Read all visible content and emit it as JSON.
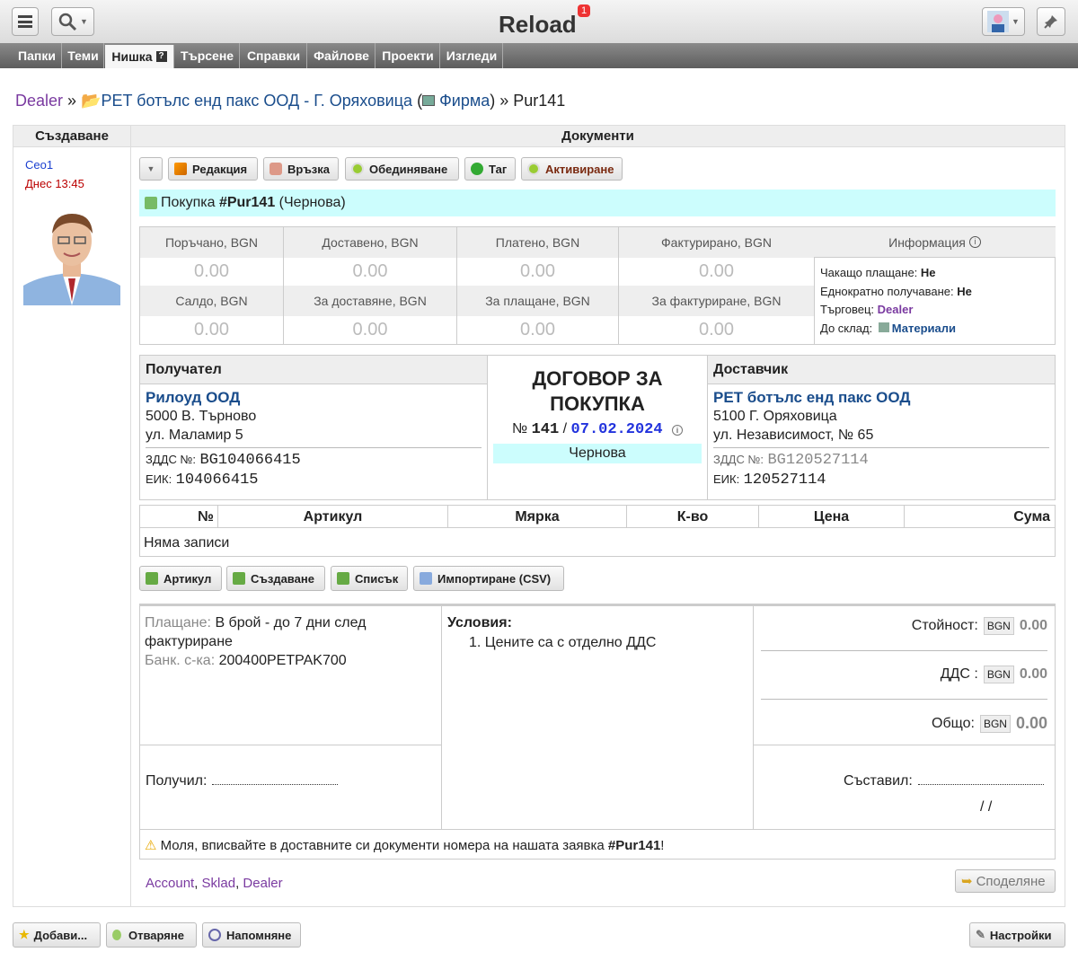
{
  "app": {
    "title": "Reload",
    "badge": "1"
  },
  "tabs": [
    "Папки",
    "Теми",
    "Нишка",
    "Търсене",
    "Справки",
    "Файлове",
    "Проекти",
    "Изгледи"
  ],
  "breadcrumb": {
    "user": "Dealer",
    "sep": "»",
    "company": "PET ботълс енд пакс ООД - Г. Оряховица",
    "paren_open": "(",
    "company_type": "Фирма",
    "paren_close": ")",
    "sep2": "»",
    "doc": "Pur141"
  },
  "side": {
    "header": "Създаване",
    "user": "Ceo1",
    "time": "Днес 13:45"
  },
  "docs": {
    "header": "Документи"
  },
  "actions": [
    "Редакция",
    "Връзка",
    "Обединяване",
    "Таг",
    "Активиране"
  ],
  "doc_title": {
    "prefix": "Покупка",
    "number": "#Pur141",
    "status": "(Чернова)"
  },
  "sums": {
    "row1": [
      "Поръчано, BGN",
      "Доставено, BGN",
      "Платено, BGN",
      "Фактурирано, BGN"
    ],
    "row1v": [
      "0.00",
      "0.00",
      "0.00",
      "0.00"
    ],
    "row2": [
      "Салдо, BGN",
      "За доставяне, BGN",
      "За плащане, BGN",
      "За фактуриране, BGN"
    ],
    "row2v": [
      "0.00",
      "0.00",
      "0.00",
      "0.00"
    ],
    "info_header": "Информация",
    "info": [
      {
        "k": "Чакащо плащане:",
        "v": "Не"
      },
      {
        "k": "Еднократно получаване:",
        "v": "Не"
      },
      {
        "k": "Търговец:",
        "v": "Dealer"
      },
      {
        "k": "До склад:",
        "v": "Материали"
      }
    ]
  },
  "receiver": {
    "header": "Получател",
    "name": "Рилоуд ООД",
    "addr1": "5000 В. Търново",
    "addr2": "ул. Маламир 5",
    "vat_label": "ЗДДС №:",
    "vat": "BG104066415",
    "eik_label": "ЕИК:",
    "eik": "104066415"
  },
  "contract": {
    "title1": "ДОГОВОР ЗА",
    "title2": "ПОКУПКА",
    "no_label": "№",
    "no": "141",
    "slash": "/",
    "date": "07.02.2024",
    "status": "Чернова"
  },
  "supplier": {
    "header": "Доставчик",
    "name": "PET ботълс енд пакс ООД",
    "addr1": "5100 Г. Оряховица",
    "addr2": "ул. Независимост, № 65",
    "vat_label": "ЗДДС №:",
    "vat": "BG120527114",
    "eik_label": "ЕИК:",
    "eik": "120527114"
  },
  "items": {
    "cols": [
      "№",
      "Артикул",
      "Мярка",
      "К-во",
      "Цена",
      "Сума"
    ],
    "empty": "Няма записи"
  },
  "item_buttons": [
    "Артикул",
    "Създаване",
    "Списък",
    "Импортиране (CSV)"
  ],
  "payment": {
    "label": "Плащане:",
    "value": "В брой - до 7 дни след фактуриране",
    "bank_label": "Банк. с-ка:",
    "bank": "200400PETPAK700"
  },
  "conditions": {
    "header": "Условия:",
    "items": [
      "1. Цените са с отделно ДДС"
    ]
  },
  "totals": [
    {
      "label": "Стойност:",
      "cur": "BGN",
      "value": "0.00"
    },
    {
      "label": "ДДС :",
      "cur": "BGN",
      "value": "0.00"
    },
    {
      "label": "Общо:",
      "cur": "BGN",
      "value": "0.00"
    }
  ],
  "received": "Получил:",
  "compiled": "Съставил:",
  "date_blank": "/ /",
  "warning": {
    "text": "Моля, вписвайте в доставните си документи номера на нашата заявка",
    "ref": "#Pur141",
    "tail": "!"
  },
  "shared": [
    "Account",
    "Sklad",
    "Dealer"
  ],
  "share_btn": "Споделяне",
  "footer": [
    "Добави...",
    "Отваряне",
    "Напомняне",
    "Настройки"
  ]
}
